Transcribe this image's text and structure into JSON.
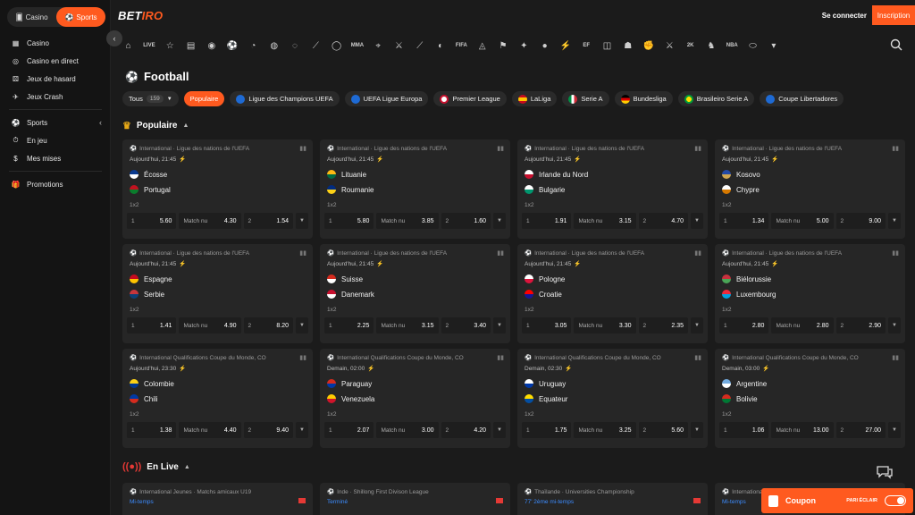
{
  "header": {
    "logo_main": "BET",
    "logo_accent": "IRO",
    "login_label": "Se connecter",
    "signup_label": "Inscription",
    "accent": "#ff5a1f"
  },
  "sidebar": {
    "switch": [
      {
        "label": "Casino",
        "icon": "casino-icon"
      },
      {
        "label": "Sports",
        "icon": "sports-icon"
      }
    ],
    "items": [
      {
        "label": "Casino",
        "icon": "slots-icon"
      },
      {
        "label": "Casino en direct",
        "icon": "live-casino-icon"
      },
      {
        "label": "Jeux de hasard",
        "icon": "dice-icon"
      },
      {
        "label": "Jeux Crash",
        "icon": "rocket-icon"
      },
      {
        "label": "Sports",
        "icon": "sports-ball-icon"
      },
      {
        "label": "En jeu",
        "icon": "live-icon"
      },
      {
        "label": "Mes mises",
        "icon": "bets-icon"
      },
      {
        "label": "Promotions",
        "icon": "gift-icon"
      }
    ]
  },
  "iconbar": [
    "home-icon",
    "live-icon",
    "star-icon",
    "document-icon",
    "league-icon",
    "football-icon",
    "tennis-icon",
    "basketball-icon",
    "volleyball-icon",
    "hockey-icon",
    "baseball-icon",
    "mma-icon",
    "esports-shooter-icon",
    "esports-strike-icon",
    "esports-valorant-icon",
    "chat-icon",
    "fifa-icon",
    "esports-dota-icon",
    "esports-game-icon",
    "esports-mobile-icon",
    "ball-icon",
    "ekick-icon",
    "efifa-icon",
    "ecricket-icon",
    "ebrasil-icon",
    "efight-icon",
    "ebattle-icon",
    "nba2k-icon",
    "chess-icon",
    "nba-icon",
    "rugby-icon"
  ],
  "page": {
    "title": "Football",
    "filters": [
      {
        "label": "Tous",
        "count": "159"
      },
      {
        "label": "Populaire"
      },
      {
        "label": "Ligue des Champions UEFA"
      },
      {
        "label": "UEFA Ligue Europa"
      },
      {
        "label": "Premier League"
      },
      {
        "label": "LaLiga"
      },
      {
        "label": "Serie A"
      },
      {
        "label": "Bundesliga"
      },
      {
        "label": "Brasileiro Serie A"
      },
      {
        "label": "Coupe Libertadores"
      }
    ],
    "popular_label": "Populaire",
    "live_label": "En Live"
  },
  "matches": [
    {
      "league": "International · Ligue des nations de l'UEFA",
      "time": "Aujourd'hui, 21:45",
      "home": "Écosse",
      "away": "Portugal",
      "hc": [
        "#0a3a8f",
        "#fff"
      ],
      "ac": [
        "#c1121f",
        "#0a7d2c"
      ],
      "type": "1x2",
      "o1": "5.60",
      "mn_label": "Match nu",
      "mn": "4.30",
      "o2": "1.54"
    },
    {
      "league": "International · Ligue des nations de l'UEFA",
      "time": "Aujourd'hui, 21:45",
      "home": "Lituanie",
      "away": "Roumanie",
      "hc": [
        "#fdb913",
        "#006a44"
      ],
      "ac": [
        "#002b7f",
        "#fcd116"
      ],
      "type": "1x2",
      "o1": "5.80",
      "mn_label": "Match nu",
      "mn": "3.85",
      "o2": "1.60"
    },
    {
      "league": "International · Ligue des nations de l'UEFA",
      "time": "Aujourd'hui, 21:45",
      "home": "Irlande du Nord",
      "away": "Bulgarie",
      "hc": [
        "#fff",
        "#c8102e"
      ],
      "ac": [
        "#fff",
        "#00966e"
      ],
      "type": "1x2",
      "o1": "1.91",
      "mn_label": "Match nu",
      "mn": "3.15",
      "o2": "4.70"
    },
    {
      "league": "International · Ligue des nations de l'UEFA",
      "time": "Aujourd'hui, 21:45",
      "home": "Kosovo",
      "away": "Chypre",
      "hc": [
        "#244aa5",
        "#d0a650"
      ],
      "ac": [
        "#fff",
        "#d57800"
      ],
      "type": "1x2",
      "o1": "1.34",
      "mn_label": "Match nu",
      "mn": "5.00",
      "o2": "9.00"
    },
    {
      "league": "International · Ligue des nations de l'UEFA",
      "time": "Aujourd'hui, 21:45",
      "home": "Espagne",
      "away": "Serbie",
      "hc": [
        "#c60b1e",
        "#ffc400"
      ],
      "ac": [
        "#c6363c",
        "#0c4076"
      ],
      "type": "1x2",
      "o1": "1.41",
      "mn_label": "Match nu",
      "mn": "4.90",
      "o2": "8.20"
    },
    {
      "league": "International · Ligue des nations de l'UEFA",
      "time": "Aujourd'hui, 21:45",
      "home": "Suisse",
      "away": "Danemark",
      "hc": [
        "#d52b1e",
        "#fff"
      ],
      "ac": [
        "#c8102e",
        "#fff"
      ],
      "type": "1x2",
      "o1": "2.25",
      "mn_label": "Match nu",
      "mn": "3.15",
      "o2": "3.40"
    },
    {
      "league": "International · Ligue des nations de l'UEFA",
      "time": "Aujourd'hui, 21:45",
      "home": "Pologne",
      "away": "Croatie",
      "hc": [
        "#fff",
        "#dc143c"
      ],
      "ac": [
        "#ff0000",
        "#171796"
      ],
      "type": "1x2",
      "o1": "3.05",
      "mn_label": "Match nu",
      "mn": "3.30",
      "o2": "2.35"
    },
    {
      "league": "International · Ligue des nations de l'UEFA",
      "time": "Aujourd'hui, 21:45",
      "home": "Biélorussie",
      "away": "Luxembourg",
      "hc": [
        "#c8313e",
        "#4aa657"
      ],
      "ac": [
        "#ed2939",
        "#00a1de"
      ],
      "type": "1x2",
      "o1": "2.80",
      "mn_label": "Match nu",
      "mn": "2.80",
      "o2": "2.90"
    },
    {
      "league": "International Qualifications Coupe du Monde, CO",
      "time": "Aujourd'hui, 23:30",
      "home": "Colombie",
      "away": "Chili",
      "hc": [
        "#fcd116",
        "#003893"
      ],
      "ac": [
        "#0039a6",
        "#d52b1e"
      ],
      "type": "1x2",
      "o1": "1.38",
      "mn_label": "Match nu",
      "mn": "4.40",
      "o2": "9.40"
    },
    {
      "league": "International Qualifications Coupe du Monde, CO",
      "time": "Demain, 02:00",
      "home": "Paraguay",
      "away": "Venezuela",
      "hc": [
        "#d52b1e",
        "#0038a8"
      ],
      "ac": [
        "#ffcc00",
        "#cf142b"
      ],
      "type": "1x2",
      "o1": "2.07",
      "mn_label": "Match nu",
      "mn": "3.00",
      "o2": "4.20"
    },
    {
      "league": "International Qualifications Coupe du Monde, CO",
      "time": "Demain, 02:30",
      "home": "Uruguay",
      "away": "Equateur",
      "hc": [
        "#fff",
        "#0038a8"
      ],
      "ac": [
        "#ffdd00",
        "#034ea2"
      ],
      "type": "1x2",
      "o1": "1.75",
      "mn_label": "Match nu",
      "mn": "3.25",
      "o2": "5.60"
    },
    {
      "league": "International Qualifications Coupe du Monde, CO",
      "time": "Demain, 03:00",
      "home": "Argentine",
      "away": "Bolivie",
      "hc": [
        "#74acdf",
        "#fff"
      ],
      "ac": [
        "#d52b1e",
        "#007934"
      ],
      "type": "1x2",
      "o1": "1.06",
      "mn_label": "Match nu",
      "mn": "13.00",
      "o2": "27.00"
    }
  ],
  "live": [
    {
      "league": "International Jeunes · Matchs amicaux U19",
      "status": "Mi-temps"
    },
    {
      "league": "Inde · Shillong First Divison League",
      "status": "Terminé"
    },
    {
      "league": "Thaïlande · Universities Championship",
      "status": "77' 2ème mi-temps"
    },
    {
      "league": "International · Matchs amicaux",
      "status": "Mi-temps"
    }
  ],
  "coupon": {
    "label": "Coupon",
    "flash_label": "PARI ÉCLAIR"
  }
}
